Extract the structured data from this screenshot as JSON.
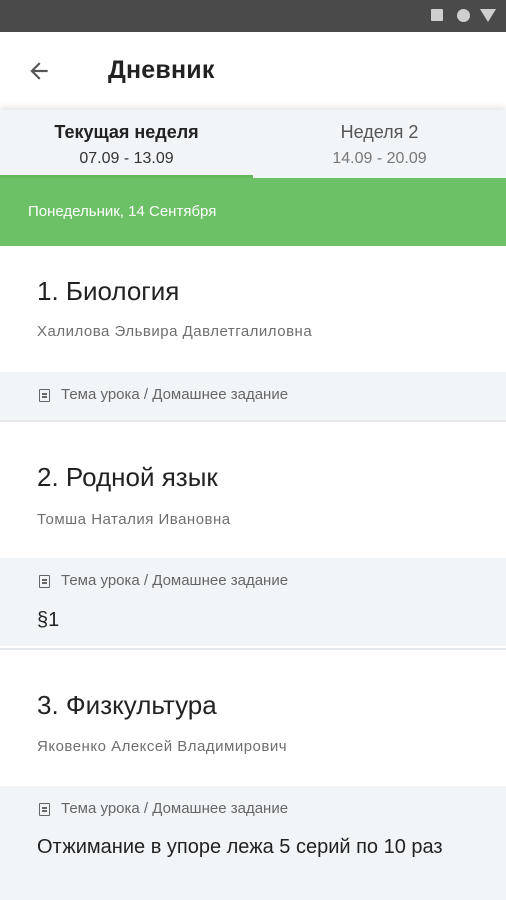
{
  "status_bar": {
    "icons": [
      "square-icon",
      "circle-icon",
      "triangle-icon"
    ]
  },
  "app_bar": {
    "title": "Дневник",
    "back_icon": "arrow-back-icon"
  },
  "tabs": [
    {
      "name": "Текущая неделя",
      "range": "07.09 - 13.09",
      "selected": true
    },
    {
      "name": "Неделя 2",
      "range": "14.09 - 20.09",
      "selected": false
    }
  ],
  "day": {
    "label": "Понедельник, 14 Сентября"
  },
  "lessons": [
    {
      "title": "1. Биология",
      "teacher": "Халилова Эльвира Давлетгалиловна",
      "hw_label": "Тема урока / Домашнее задание",
      "hw_text": ""
    },
    {
      "title": "2. Родной язык",
      "teacher": "Томша Наталия Ивановна",
      "hw_label": "Тема урока / Домашнее задание",
      "hw_text": "§1"
    },
    {
      "title": "3. Физкультура",
      "teacher": "Яковенко Алексей Владимирович",
      "hw_label": "Тема урока / Домашнее задание",
      "hw_text": "Отжимание в упоре лежа 5 серий по 10 раз"
    }
  ],
  "colors": {
    "accent": "#6cc065",
    "status_bar": "#4a4a4a",
    "hw_background": "#f2f5f8"
  }
}
